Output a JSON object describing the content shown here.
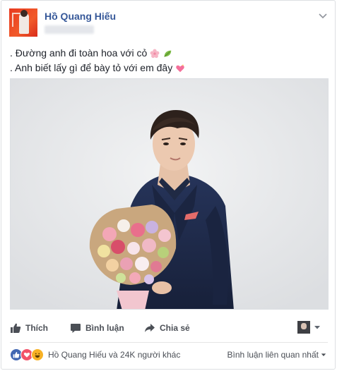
{
  "post": {
    "author": "Hồ Quang Hiếu",
    "lines": [
      ". Đường anh đi toàn hoa với cỏ",
      ". Anh biết lấy gì để bày tỏ với em đây"
    ],
    "line_emojis": [
      [
        "cherry-blossom-icon",
        "leaves-icon"
      ],
      [
        "sparkling-heart-icon"
      ]
    ]
  },
  "actions": {
    "like_label": "Thích",
    "comment_label": "Bình luận",
    "share_label": "Chia sẻ"
  },
  "reactions": {
    "types": [
      "like",
      "love",
      "haha"
    ],
    "summary": "Hồ Quang Hiếu và 24K người khác",
    "sort_label": "Bình luận liên quan nhất"
  },
  "colors": {
    "link_blue": "#365899",
    "like_blue": "#4267b2",
    "love_red": "#f25268",
    "haha_yellow": "#f7b125",
    "suit_navy": "#1f2b49"
  }
}
